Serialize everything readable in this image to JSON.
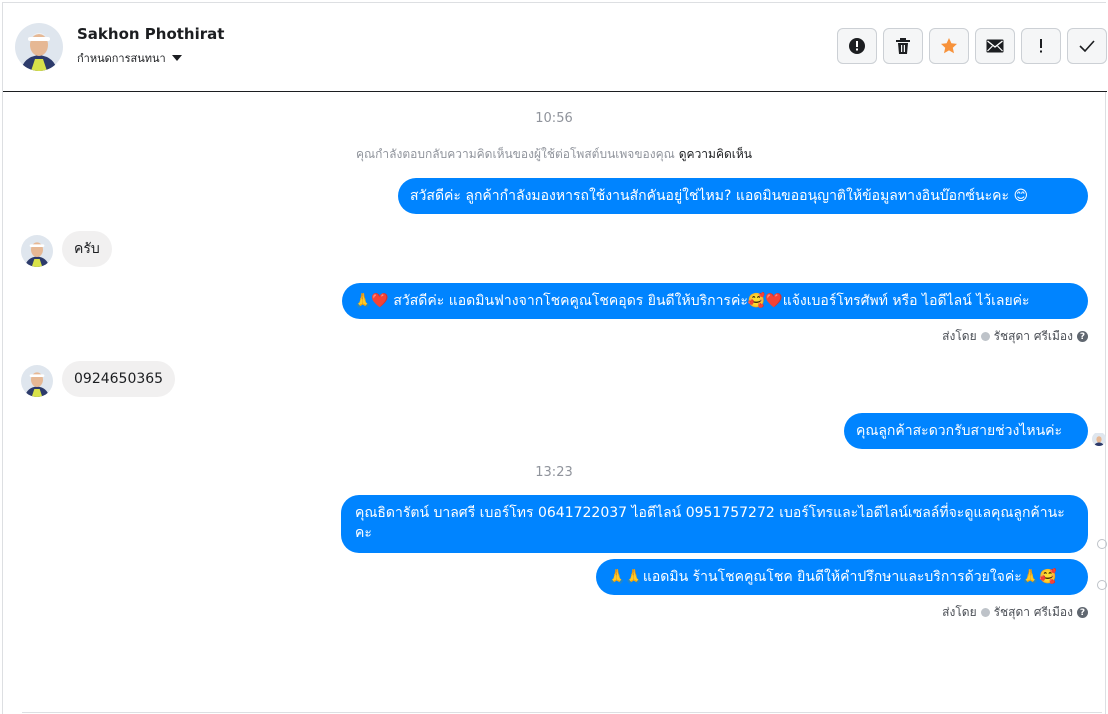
{
  "header": {
    "contact_name": "Sakhon Phothirat",
    "assign_label": "กำหนดการสนทนา"
  },
  "toolbar": {
    "buttons": [
      {
        "name": "report-spam",
        "icon": "alert-circle-icon"
      },
      {
        "name": "delete",
        "icon": "trash-icon"
      },
      {
        "name": "star",
        "icon": "star-icon"
      },
      {
        "name": "mark-unread",
        "icon": "envelope-icon"
      },
      {
        "name": "follow-up",
        "icon": "exclamation-icon"
      },
      {
        "name": "mark-done",
        "icon": "check-icon"
      }
    ]
  },
  "conversation": {
    "time_1": "10:56",
    "system_notice": "คุณกำลังตอบกลับความคิดเห็นของผู้ใช้ต่อโพสต์บนเพจของคุณ",
    "system_link": "ดูความคิดเห็น",
    "msg_1": "สวัสดีค่ะ ลูกค้ากำลังมองหารถใช้งานสักคันอยู่ใช่ไหม? แอดมินขออนุญาติให้ข้อมูลทางอินบ๊อกซ์นะคะ 😊",
    "msg_2": "ครับ",
    "msg_3": "🙏❤️ สวัสดีค่ะ แอดมินฟางจากโชคคูณโชคอุดร ยินดีให้บริการค่ะ🥰❤️แจ้งเบอร์โทรศัพท์ หรือ ไอดีไลน์  ไว้เลยค่ะ",
    "sent_by_label": "ส่งโดย",
    "sender_name": "รัชสุดา ศรีเมือง",
    "msg_4": "0924650365",
    "msg_5": "คุณลูกค้าสะดวกรับสายช่วงไหนค่ะ",
    "time_2": "13:23",
    "msg_6": "คุณธิดารัตน์ บาลศรี เบอร์โทร 0641722037  ไอดีไลน์ 0951757272   เบอร์โทรและไอดีไลน์เซลล์ที่จะดูแลคุณลูกค้านะคะ",
    "msg_7": "🙏🙏แอดมิน ร้านโชคคูณโชค ยินดีให้คำปรึกษาและบริการด้วยใจค่ะ🙏🥰",
    "help_mark": "?"
  },
  "colors": {
    "outgoing_bubble": "#0084ff",
    "incoming_bubble": "#f1f0f0",
    "star": "#f7923b"
  }
}
